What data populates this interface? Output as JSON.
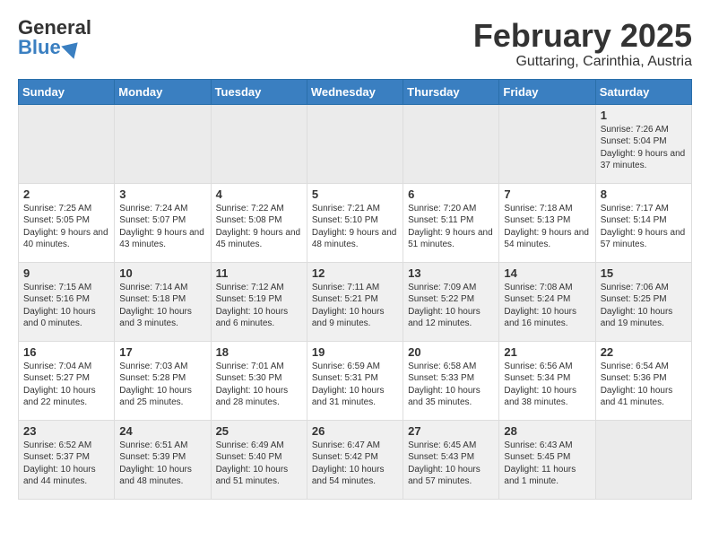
{
  "header": {
    "logo_general": "General",
    "logo_blue": "Blue",
    "month_title": "February 2025",
    "location": "Guttaring, Carinthia, Austria"
  },
  "weekdays": [
    "Sunday",
    "Monday",
    "Tuesday",
    "Wednesday",
    "Thursday",
    "Friday",
    "Saturday"
  ],
  "weeks": [
    [
      {
        "day": "",
        "info": ""
      },
      {
        "day": "",
        "info": ""
      },
      {
        "day": "",
        "info": ""
      },
      {
        "day": "",
        "info": ""
      },
      {
        "day": "",
        "info": ""
      },
      {
        "day": "",
        "info": ""
      },
      {
        "day": "1",
        "info": "Sunrise: 7:26 AM\nSunset: 5:04 PM\nDaylight: 9 hours and 37 minutes."
      }
    ],
    [
      {
        "day": "2",
        "info": "Sunrise: 7:25 AM\nSunset: 5:05 PM\nDaylight: 9 hours and 40 minutes."
      },
      {
        "day": "3",
        "info": "Sunrise: 7:24 AM\nSunset: 5:07 PM\nDaylight: 9 hours and 43 minutes."
      },
      {
        "day": "4",
        "info": "Sunrise: 7:22 AM\nSunset: 5:08 PM\nDaylight: 9 hours and 45 minutes."
      },
      {
        "day": "5",
        "info": "Sunrise: 7:21 AM\nSunset: 5:10 PM\nDaylight: 9 hours and 48 minutes."
      },
      {
        "day": "6",
        "info": "Sunrise: 7:20 AM\nSunset: 5:11 PM\nDaylight: 9 hours and 51 minutes."
      },
      {
        "day": "7",
        "info": "Sunrise: 7:18 AM\nSunset: 5:13 PM\nDaylight: 9 hours and 54 minutes."
      },
      {
        "day": "8",
        "info": "Sunrise: 7:17 AM\nSunset: 5:14 PM\nDaylight: 9 hours and 57 minutes."
      }
    ],
    [
      {
        "day": "9",
        "info": "Sunrise: 7:15 AM\nSunset: 5:16 PM\nDaylight: 10 hours and 0 minutes."
      },
      {
        "day": "10",
        "info": "Sunrise: 7:14 AM\nSunset: 5:18 PM\nDaylight: 10 hours and 3 minutes."
      },
      {
        "day": "11",
        "info": "Sunrise: 7:12 AM\nSunset: 5:19 PM\nDaylight: 10 hours and 6 minutes."
      },
      {
        "day": "12",
        "info": "Sunrise: 7:11 AM\nSunset: 5:21 PM\nDaylight: 10 hours and 9 minutes."
      },
      {
        "day": "13",
        "info": "Sunrise: 7:09 AM\nSunset: 5:22 PM\nDaylight: 10 hours and 12 minutes."
      },
      {
        "day": "14",
        "info": "Sunrise: 7:08 AM\nSunset: 5:24 PM\nDaylight: 10 hours and 16 minutes."
      },
      {
        "day": "15",
        "info": "Sunrise: 7:06 AM\nSunset: 5:25 PM\nDaylight: 10 hours and 19 minutes."
      }
    ],
    [
      {
        "day": "16",
        "info": "Sunrise: 7:04 AM\nSunset: 5:27 PM\nDaylight: 10 hours and 22 minutes."
      },
      {
        "day": "17",
        "info": "Sunrise: 7:03 AM\nSunset: 5:28 PM\nDaylight: 10 hours and 25 minutes."
      },
      {
        "day": "18",
        "info": "Sunrise: 7:01 AM\nSunset: 5:30 PM\nDaylight: 10 hours and 28 minutes."
      },
      {
        "day": "19",
        "info": "Sunrise: 6:59 AM\nSunset: 5:31 PM\nDaylight: 10 hours and 31 minutes."
      },
      {
        "day": "20",
        "info": "Sunrise: 6:58 AM\nSunset: 5:33 PM\nDaylight: 10 hours and 35 minutes."
      },
      {
        "day": "21",
        "info": "Sunrise: 6:56 AM\nSunset: 5:34 PM\nDaylight: 10 hours and 38 minutes."
      },
      {
        "day": "22",
        "info": "Sunrise: 6:54 AM\nSunset: 5:36 PM\nDaylight: 10 hours and 41 minutes."
      }
    ],
    [
      {
        "day": "23",
        "info": "Sunrise: 6:52 AM\nSunset: 5:37 PM\nDaylight: 10 hours and 44 minutes."
      },
      {
        "day": "24",
        "info": "Sunrise: 6:51 AM\nSunset: 5:39 PM\nDaylight: 10 hours and 48 minutes."
      },
      {
        "day": "25",
        "info": "Sunrise: 6:49 AM\nSunset: 5:40 PM\nDaylight: 10 hours and 51 minutes."
      },
      {
        "day": "26",
        "info": "Sunrise: 6:47 AM\nSunset: 5:42 PM\nDaylight: 10 hours and 54 minutes."
      },
      {
        "day": "27",
        "info": "Sunrise: 6:45 AM\nSunset: 5:43 PM\nDaylight: 10 hours and 57 minutes."
      },
      {
        "day": "28",
        "info": "Sunrise: 6:43 AM\nSunset: 5:45 PM\nDaylight: 11 hours and 1 minute."
      },
      {
        "day": "",
        "info": ""
      }
    ]
  ]
}
